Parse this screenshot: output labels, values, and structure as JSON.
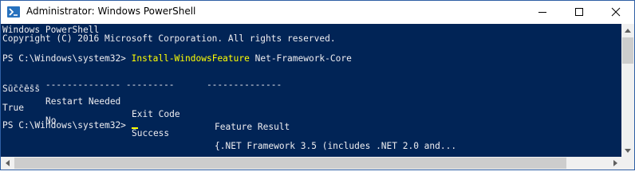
{
  "window": {
    "title": "Administrator: Windows PowerShell",
    "icon": "powershell-icon",
    "accent_color": "#012456",
    "prompt_command_color": "#ffff00",
    "text_color": "#eeedf0",
    "controls": [
      "minimize-icon",
      "maximize-icon",
      "close-icon"
    ]
  },
  "console": {
    "banner_line_1": "Windows PowerShell",
    "banner_line_2": "Copyright (C) 2016 Microsoft Corporation. All rights reserved.",
    "prompt": "PS C:\\Windows\\system32>",
    "command_name": "Install-WindowsFeature",
    "command_args": "Net-Framework-Core",
    "table": {
      "headers": [
        "Success",
        "Restart Needed",
        "Exit Code",
        "Feature Result"
      ],
      "separator": "------- -------------- ---------      --------------",
      "rows": [
        [
          "True",
          "No",
          "Success",
          "{.NET Framework 3.5 (includes .NET 2.0 and..."
        ]
      ]
    },
    "final_prompt": "PS C:\\Windows\\system32>"
  }
}
